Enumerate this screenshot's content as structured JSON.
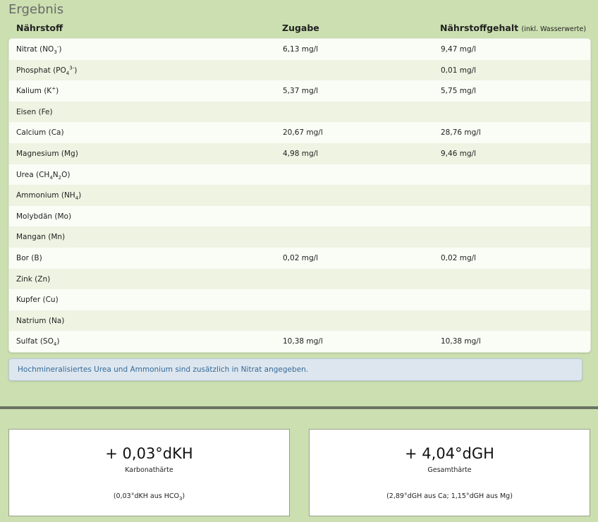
{
  "title": "Ergebnis",
  "columns": {
    "nutrient": "Nährstoff",
    "addition": "Zugabe",
    "content": "Nährstoffgehalt",
    "content_note": "(inkl. Wasserwerte)"
  },
  "rows": [
    {
      "name": "Nitrat (NO",
      "sub": "3",
      "sup": "-",
      "tail": ")",
      "addition": "6,13 mg/l",
      "content": "9,47 mg/l"
    },
    {
      "name": "Phosphat (PO",
      "sub": "4",
      "sup": "3-",
      "tail": ")",
      "addition": "",
      "content": "0,01 mg/l"
    },
    {
      "name": "Kalium (K",
      "sub": "",
      "sup": "+",
      "tail": ")",
      "addition": "5,37 mg/l",
      "content": "5,75 mg/l"
    },
    {
      "name": "Eisen (Fe)",
      "sub": "",
      "sup": "",
      "tail": "",
      "addition": "",
      "content": ""
    },
    {
      "name": "Calcium (Ca)",
      "sub": "",
      "sup": "",
      "tail": "",
      "addition": "20,67 mg/l",
      "content": "28,76 mg/l"
    },
    {
      "name": "Magnesium (Mg)",
      "sub": "",
      "sup": "",
      "tail": "",
      "addition": "4,98 mg/l",
      "content": "9,46 mg/l"
    },
    {
      "name": "Urea (CH",
      "sub": "4",
      "sup": "",
      "tail": "N",
      "sub2": "2",
      "tail2": "O)",
      "addition": "",
      "content": ""
    },
    {
      "name": "Ammonium (NH",
      "sub": "4",
      "sup": "",
      "tail": ")",
      "addition": "",
      "content": ""
    },
    {
      "name": "Molybdän (Mo)",
      "sub": "",
      "sup": "",
      "tail": "",
      "addition": "",
      "content": ""
    },
    {
      "name": "Mangan (Mn)",
      "sub": "",
      "sup": "",
      "tail": "",
      "addition": "",
      "content": ""
    },
    {
      "name": "Bor (B)",
      "sub": "",
      "sup": "",
      "tail": "",
      "addition": "0,02 mg/l",
      "content": "0,02 mg/l"
    },
    {
      "name": "Zink (Zn)",
      "sub": "",
      "sup": "",
      "tail": "",
      "addition": "",
      "content": ""
    },
    {
      "name": "Kupfer (Cu)",
      "sub": "",
      "sup": "",
      "tail": "",
      "addition": "",
      "content": ""
    },
    {
      "name": "Natrium (Na)",
      "sub": "",
      "sup": "",
      "tail": "",
      "addition": "",
      "content": ""
    },
    {
      "name": "Sulfat (SO",
      "sub": "4",
      "sup": "",
      "tail": ")",
      "addition": "10,38 mg/l",
      "content": "10,38 mg/l"
    }
  ],
  "info_text": "Hochmineralisiertes Urea und Ammonium sind zusätzlich in Nitrat angegeben.",
  "cards": {
    "kh": {
      "value": "+ 0,03°dKH",
      "label": "Karbonathärte",
      "detail": "(0,03°dKH aus HCO",
      "detail_sub": "3",
      "detail_tail": ")"
    },
    "gh": {
      "value": "+ 4,04°dGH",
      "label": "Gesamthärte",
      "detail": "(2,89°dGH aus Ca; 1,15°dGH aus Mg)"
    }
  }
}
